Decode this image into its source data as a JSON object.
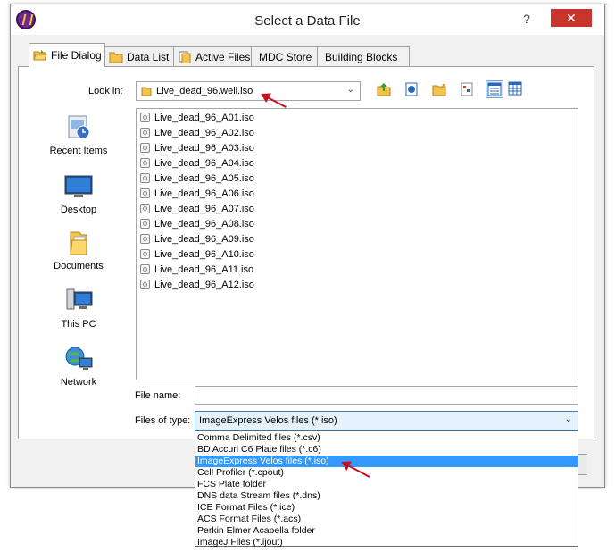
{
  "window": {
    "title": "Select a Data File",
    "close_glyph": "✕",
    "help_glyph": "?"
  },
  "tabs": [
    {
      "label": "File Dialog",
      "icon": "open-folder-icon"
    },
    {
      "label": "Data List",
      "icon": "folder-icon"
    },
    {
      "label": "Active Files",
      "icon": "files-icon"
    },
    {
      "label": "MDC Store",
      "icon": ""
    },
    {
      "label": "Building Blocks",
      "icon": ""
    }
  ],
  "look_in": {
    "label": "Look in:",
    "value": "Live_dead_96.well.iso"
  },
  "places": [
    {
      "label": "Recent Items",
      "icon": "recent-items-icon"
    },
    {
      "label": "Desktop",
      "icon": "desktop-icon"
    },
    {
      "label": "Documents",
      "icon": "documents-icon"
    },
    {
      "label": "This PC",
      "icon": "this-pc-icon"
    },
    {
      "label": "Network",
      "icon": "network-icon"
    }
  ],
  "files": [
    "Live_dead_96_A01.iso",
    "Live_dead_96_A02.iso",
    "Live_dead_96_A03.iso",
    "Live_dead_96_A04.iso",
    "Live_dead_96_A05.iso",
    "Live_dead_96_A06.iso",
    "Live_dead_96_A07.iso",
    "Live_dead_96_A08.iso",
    "Live_dead_96_A09.iso",
    "Live_dead_96_A10.iso",
    "Live_dead_96_A11.iso",
    "Live_dead_96_A12.iso"
  ],
  "file_name": {
    "label": "File name:",
    "value": ""
  },
  "file_type": {
    "label": "Files of type:",
    "value": "ImageExpress Velos files (*.iso)",
    "options": [
      "Comma Delimited files (*.csv)",
      "BD Accuri C6 Plate files (*.c6)",
      "ImageExpress Velos files (*.iso)",
      "Cell Profiler (*.cpout)",
      "FCS Plate folder",
      "DNS data Stream files (*.dns)",
      "ICE Format Files (*.ice)",
      "ACS Format Files (*.acs)",
      "Perkin Elmer Acapella folder",
      "ImageJ Files (*.ijout)"
    ],
    "selected_index": 2
  },
  "colors": {
    "selection": "#3399ff",
    "annotation_arrow": "#c8101a",
    "close_button": "#c7352c"
  }
}
